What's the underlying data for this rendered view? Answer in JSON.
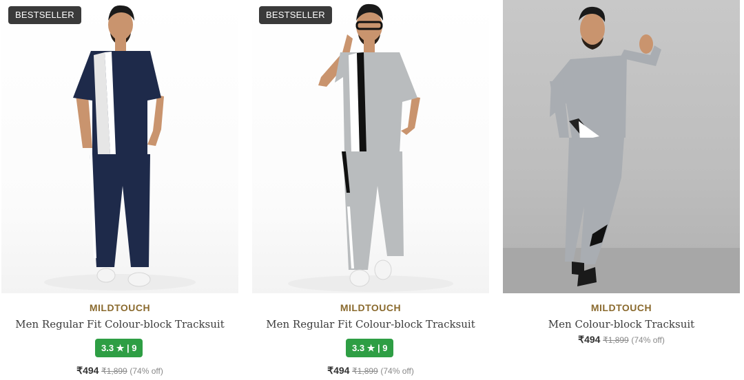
{
  "products": [
    {
      "badge": "BESTSELLER",
      "brand": "MILDTOUCH",
      "title": "Men Regular Fit Colour-block Tracksuit",
      "rating": "3.3",
      "rating_star": "★",
      "rating_sep": "|",
      "rating_count": "9",
      "price": "₹494",
      "mrp": "₹1,899",
      "discount": "(74% off)",
      "top_color": "#1e2a4a",
      "pant_color": "#1e2a4a"
    },
    {
      "badge": "BESTSELLER",
      "brand": "MILDTOUCH",
      "title": "Men Regular Fit Colour-block Tracksuit",
      "rating": "3.3",
      "rating_star": "★",
      "rating_sep": "|",
      "rating_count": "9",
      "price": "₹494",
      "mrp": "₹1,899",
      "discount": "(74% off)",
      "top_color": "#b9bcbe",
      "pant_color": "#b9bcbe"
    },
    {
      "brand": "MILDTOUCH",
      "title": "Men Colour-block Tracksuit",
      "price": "₹494",
      "mrp": "₹1,899",
      "discount": "(74% off)",
      "top_color": "#a9adb2",
      "pant_color": "#a9adb2"
    }
  ],
  "colors": {
    "badge_bg": "#3a3a3a",
    "rating_bg": "#2e9e44",
    "brand_text": "#8a6a2e"
  }
}
